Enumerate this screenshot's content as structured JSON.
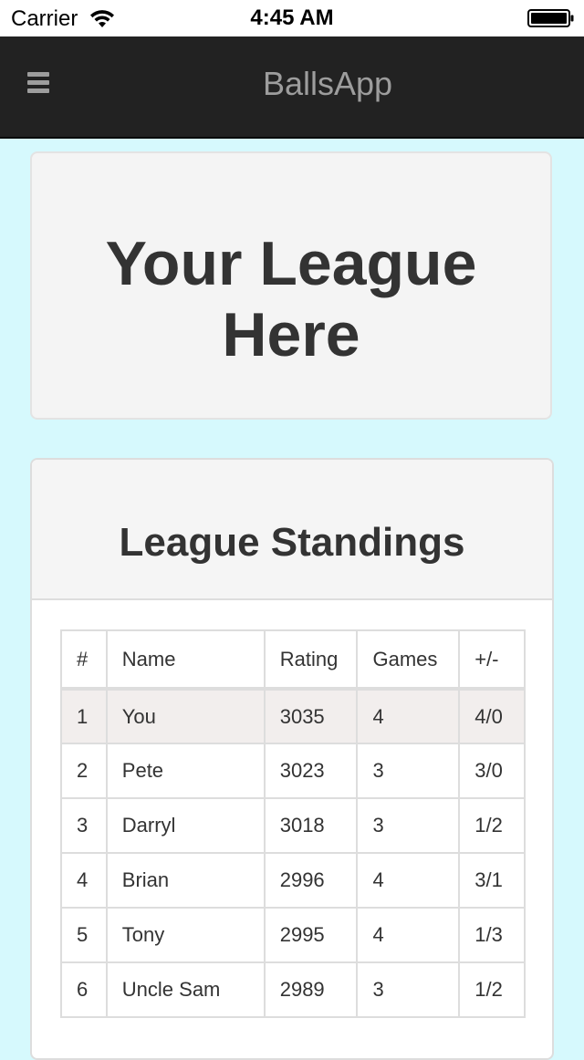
{
  "status_bar": {
    "carrier": "Carrier",
    "time": "4:45 AM"
  },
  "navbar": {
    "brand": "BallsApp",
    "menu_icon": "hamburger-menu-icon"
  },
  "hero": {
    "title_line1": "Your League",
    "title_line2": "Here"
  },
  "standings": {
    "title": "League Standings",
    "columns": [
      "#",
      "Name",
      "Rating",
      "Games",
      "+/-"
    ],
    "rows": [
      [
        "1",
        "You",
        "3035",
        "4",
        "4/0"
      ],
      [
        "2",
        "Pete",
        "3023",
        "3",
        "3/0"
      ],
      [
        "3",
        "Darryl",
        "3018",
        "3",
        "1/2"
      ],
      [
        "4",
        "Brian",
        "2996",
        "4",
        "3/1"
      ],
      [
        "5",
        "Tony",
        "2995",
        "4",
        "1/3"
      ],
      [
        "6",
        "Uncle Sam",
        "2989",
        "3",
        "1/2"
      ]
    ]
  },
  "colors": {
    "background": "#d6f9fd",
    "navbar": "#222222",
    "navbar_text": "#9d9d9d",
    "highlight_row": "#f2eeed"
  }
}
